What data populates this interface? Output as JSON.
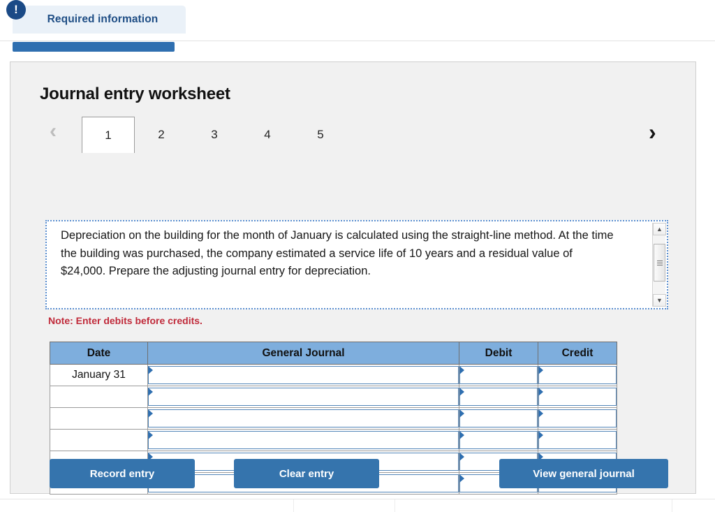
{
  "header": {
    "badge_icon": "alert-exclamation-icon",
    "badge_glyph": "!",
    "required_tab_label": "Required information"
  },
  "panel": {
    "title": "Journal entry worksheet"
  },
  "pager": {
    "prev_icon": "chevron-left-icon",
    "prev_glyph": "‹",
    "next_icon": "chevron-right-icon",
    "next_glyph": "›",
    "active_tab": "1",
    "tabs": [
      {
        "label": "1",
        "active": true
      },
      {
        "label": "2",
        "active": false
      },
      {
        "label": "3",
        "active": false
      },
      {
        "label": "4",
        "active": false
      },
      {
        "label": "5",
        "active": false
      }
    ]
  },
  "question": {
    "text": "Depreciation on the building for the month of January is calculated using the straight-line method. At the time the building was purchased, the company estimated a service life of 10 years and a residual value of $24,000. Prepare the adjusting journal entry for depreciation.",
    "scroll_up_glyph": "▲",
    "scroll_down_glyph": "▼"
  },
  "note": {
    "text": "Note: Enter debits before credits.",
    "color": "#c02a3a"
  },
  "table": {
    "columns": [
      "Date",
      "General Journal",
      "Debit",
      "Credit"
    ],
    "rows": [
      {
        "date": "January 31",
        "general_journal": "",
        "debit": "",
        "credit": ""
      },
      {
        "date": "",
        "general_journal": "",
        "debit": "",
        "credit": ""
      },
      {
        "date": "",
        "general_journal": "",
        "debit": "",
        "credit": ""
      },
      {
        "date": "",
        "general_journal": "",
        "debit": "",
        "credit": ""
      },
      {
        "date": "",
        "general_journal": "",
        "debit": "",
        "credit": ""
      },
      {
        "date": "",
        "general_journal": "",
        "debit": "",
        "credit": ""
      }
    ],
    "header_color": "#7eaedd"
  },
  "buttons": {
    "record": "Record entry",
    "clear": "Clear entry",
    "view": "View general journal",
    "color": "#3574ad"
  }
}
